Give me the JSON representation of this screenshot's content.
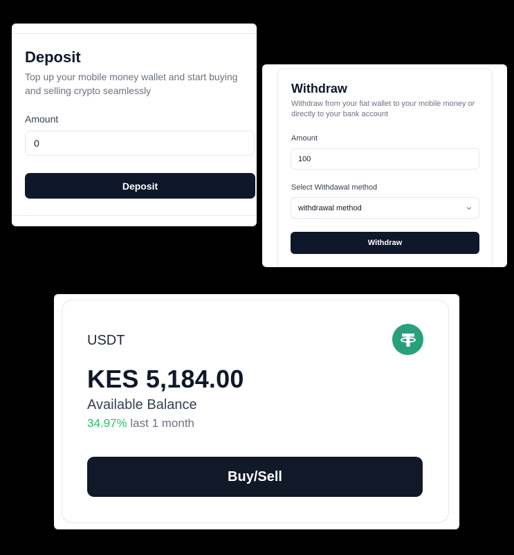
{
  "deposit": {
    "title": "Deposit",
    "description": "Top up your mobile money wallet and start buying and selling crypto seamlessly",
    "amount_label": "Amount",
    "amount_value": "0",
    "button_label": "Deposit"
  },
  "withdraw": {
    "title": "Withdraw",
    "description": "Withdraw from your fiat wallet to your mobile money or directly to your bank account",
    "amount_label": "Amount",
    "amount_value": "100",
    "method_label": "Select Withdawal method",
    "method_value": "withdrawal method",
    "button_label": "Withdraw"
  },
  "balance": {
    "asset": "USDT",
    "asset_icon": "tether-icon",
    "amount": "KES 5,184.00",
    "subtitle": "Available Balance",
    "change_pct": "34.97%",
    "change_period": "last 1 month",
    "button_label": "Buy/Sell"
  },
  "colors": {
    "background": "#000000",
    "primary_button": "#0f172a",
    "positive": "#22c55e",
    "tether": "#26a17b"
  }
}
